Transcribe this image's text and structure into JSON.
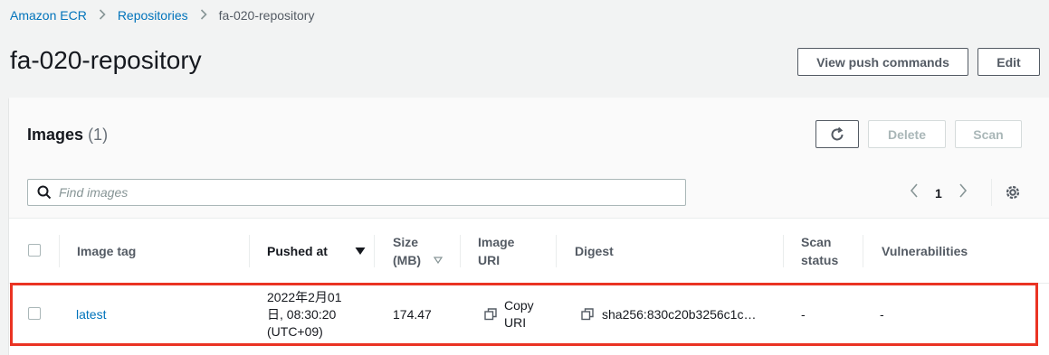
{
  "breadcrumb": {
    "items": [
      "Amazon ECR",
      "Repositories"
    ],
    "current": "fa-020-repository"
  },
  "page": {
    "title": "fa-020-repository",
    "view_push_label": "View push commands",
    "edit_label": "Edit"
  },
  "images": {
    "title": "Images",
    "count": "(1)",
    "delete_label": "Delete",
    "scan_label": "Scan",
    "search_placeholder": "Find images",
    "page_number": "1",
    "columns": {
      "image_tag": "Image tag",
      "pushed_at": "Pushed at",
      "size_line1": "Size",
      "size_line2": "(MB)",
      "uri_line1": "Image",
      "uri_line2": "URI",
      "digest": "Digest",
      "scan_line1": "Scan",
      "scan_line2": "status",
      "vulnerabilities": "Vulnerabilities"
    },
    "rows": [
      {
        "tag": "latest",
        "pushed_line1": "2022年2月01",
        "pushed_line2": "日, 08:30:20",
        "pushed_line3": "(UTC+09)",
        "size": "174.47",
        "uri_line1": "Copy",
        "uri_line2": "URI",
        "digest": "sha256:830c20b3256c1c…",
        "scan_status": "-",
        "vulnerabilities": "-"
      }
    ]
  },
  "colors": {
    "link": "#0073bb",
    "highlight": "#ea3323"
  }
}
